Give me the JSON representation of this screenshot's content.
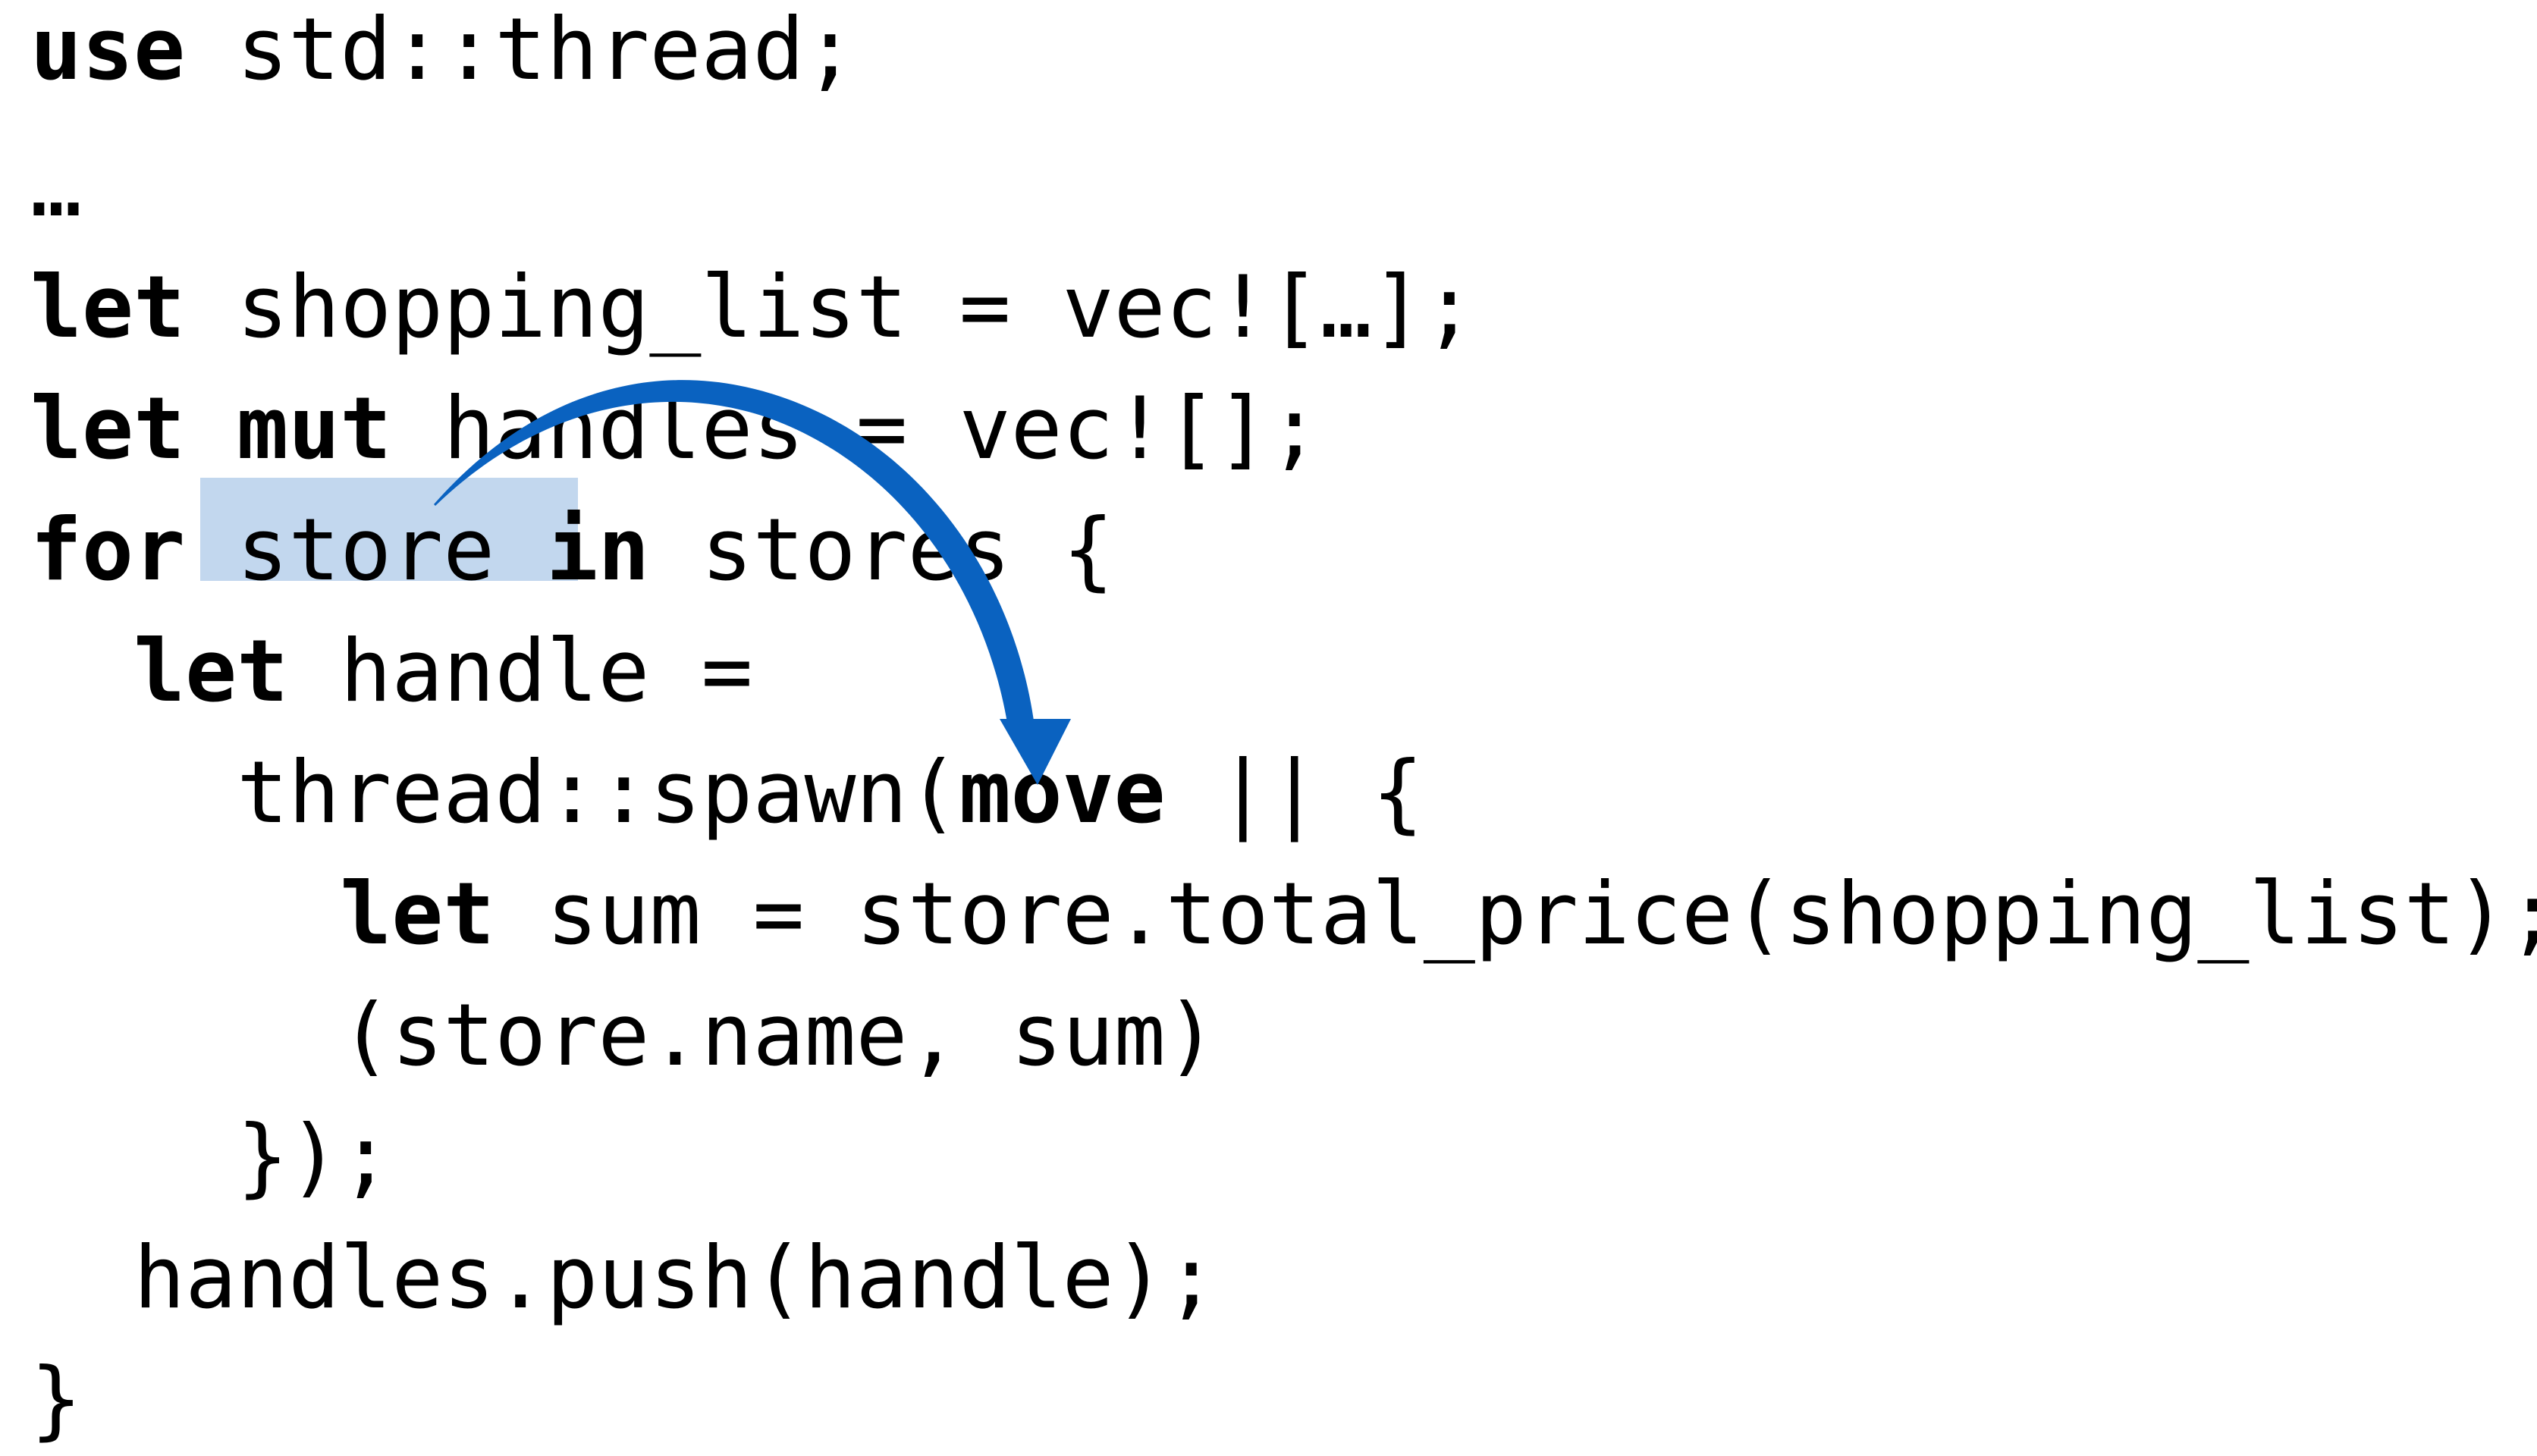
{
  "code": {
    "line1": {
      "kw": "use",
      "rest": " std::thread;"
    },
    "line2": {
      "text": "…"
    },
    "line3": {
      "kw": "let",
      "rest": " shopping_list = vec![…];"
    },
    "line4": {
      "kw1": "let",
      "sp": " ",
      "kw2": "mut",
      "rest": " handles = vec![];"
    },
    "line5": {
      "kw1": "for",
      "pre": " ",
      "var": "store ",
      "kw2": "in",
      "rest": " stores {"
    },
    "line6": {
      "indent": "  ",
      "kw": "let",
      "rest": " handle ="
    },
    "line7": {
      "pre": "    thread::spawn(",
      "kw": "move",
      "rest": " || {"
    },
    "line8": {
      "indent": "      ",
      "kw": "let",
      "rest": " sum = store.total_price(shopping_list);"
    },
    "line9": {
      "text": "      (store.name, sum)"
    },
    "line10": {
      "text": "    });"
    },
    "line11": {
      "text": "  handles.push(handle);"
    },
    "line12": {
      "text": "}"
    }
  },
  "colors": {
    "highlight": "#c2d7ee",
    "arrow": "#0a62c0",
    "text": "#000000",
    "background": "#ffffff"
  },
  "icons": {
    "arrow": "curved-arrow-icon"
  }
}
